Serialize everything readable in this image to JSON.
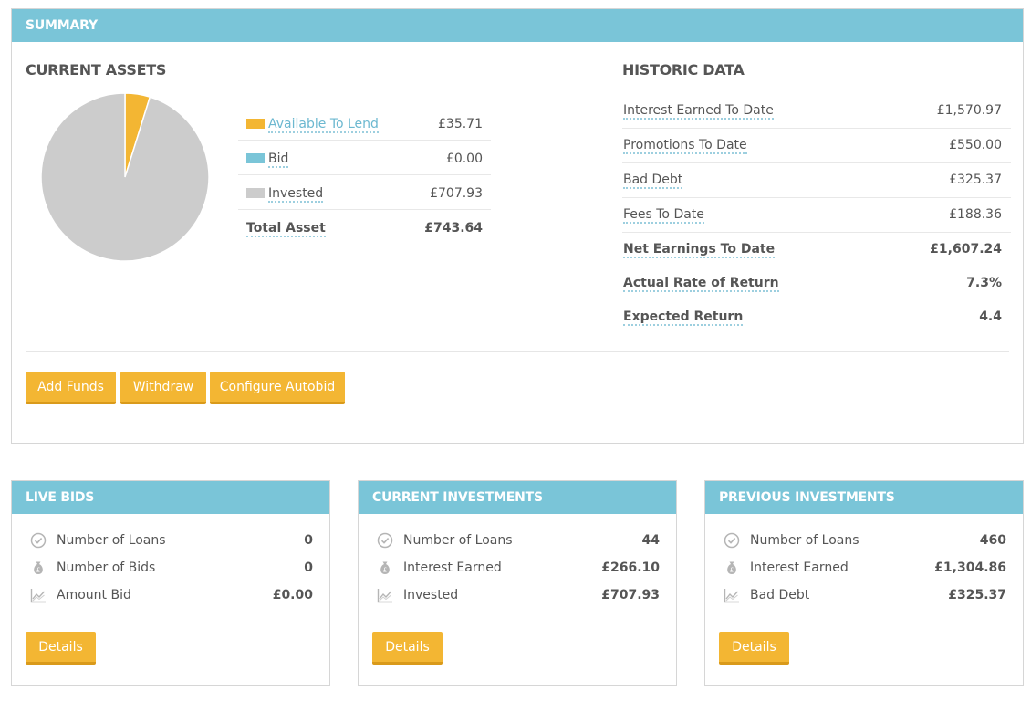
{
  "summary": {
    "title": "SUMMARY",
    "current_assets": {
      "title": "CURRENT ASSETS",
      "legend": [
        {
          "label": "Available To Lend",
          "value": "£35.71",
          "color": "#f3b633",
          "amount": 35.71
        },
        {
          "label": "Bid",
          "value": "£0.00",
          "color": "#7ac5d8",
          "amount": 0.0
        },
        {
          "label": "Invested",
          "value": "£707.93",
          "color": "#cccccc",
          "amount": 707.93
        }
      ],
      "total_label": "Total Asset",
      "total_value": "£743.64"
    },
    "historic": {
      "title": "HISTORIC DATA",
      "rows": [
        {
          "label": "Interest Earned To Date",
          "value": "£1,570.97"
        },
        {
          "label": "Promotions To Date",
          "value": "£550.00"
        },
        {
          "label": "Bad Debt",
          "value": "£325.37"
        },
        {
          "label": "Fees To Date",
          "value": "£188.36"
        }
      ],
      "bold_rows": [
        {
          "label": "Net Earnings To Date",
          "value": "£1,607.24"
        },
        {
          "label": "Actual Rate of Return",
          "value": "7.3%"
        },
        {
          "label": "Expected Return",
          "value": "4.4"
        }
      ]
    },
    "buttons": {
      "add_funds": "Add Funds",
      "withdraw": "Withdraw",
      "configure_autobid": "Configure Autobid"
    }
  },
  "live_bids": {
    "title": "LIVE BIDS",
    "stats": [
      {
        "icon": "check-circle-icon",
        "label": "Number of Loans",
        "value": "0"
      },
      {
        "icon": "money-bag-icon",
        "label": "Number of Bids",
        "value": "0"
      },
      {
        "icon": "chart-line-icon",
        "label": "Amount Bid",
        "value": "£0.00"
      }
    ],
    "details": "Details"
  },
  "current_investments": {
    "title": "CURRENT INVESTMENTS",
    "stats": [
      {
        "icon": "check-circle-icon",
        "label": "Number of Loans",
        "value": "44"
      },
      {
        "icon": "money-bag-icon",
        "label": "Interest Earned",
        "value": "£266.10"
      },
      {
        "icon": "chart-line-icon",
        "label": "Invested",
        "value": "£707.93"
      }
    ],
    "details": "Details"
  },
  "previous_investments": {
    "title": "PREVIOUS INVESTMENTS",
    "stats": [
      {
        "icon": "check-circle-icon",
        "label": "Number of Loans",
        "value": "460"
      },
      {
        "icon": "money-bag-icon",
        "label": "Interest Earned",
        "value": "£1,304.86"
      },
      {
        "icon": "chart-line-icon",
        "label": "Bad Debt",
        "value": "£325.37"
      }
    ],
    "details": "Details"
  },
  "colors": {
    "header": "#7ac5d8",
    "button": "#f3b633",
    "link_underline": "#9dcfdf"
  }
}
